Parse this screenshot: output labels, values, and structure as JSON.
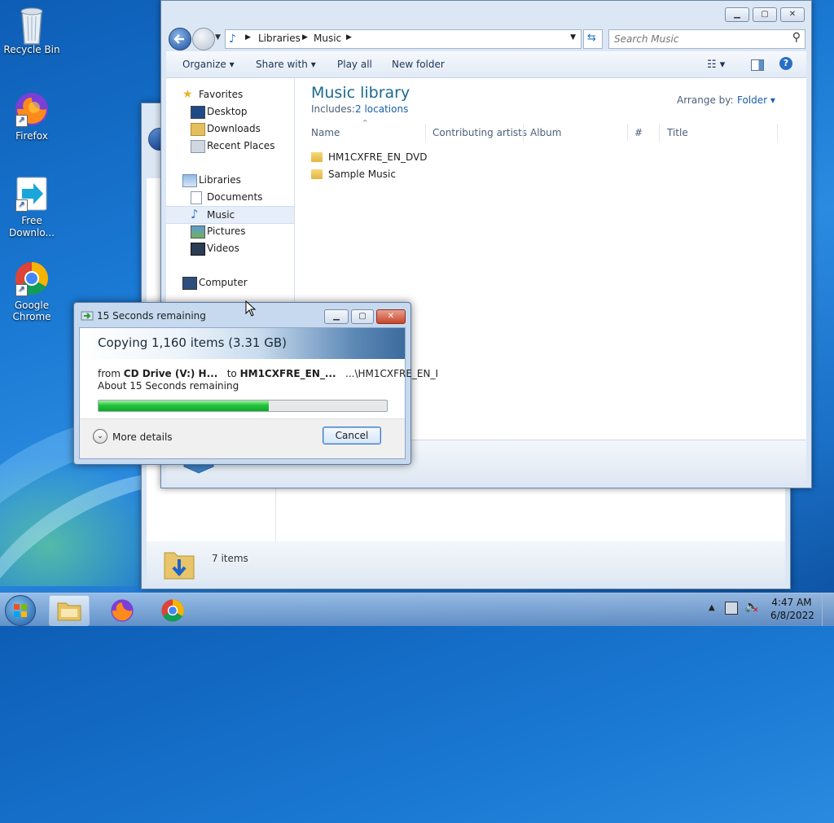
{
  "desktop": {
    "icons": [
      {
        "label": "Recycle Bin"
      },
      {
        "label": "Firefox"
      },
      {
        "label": "Free Downlo..."
      },
      {
        "label": "Google Chrome"
      }
    ]
  },
  "explorer": {
    "breadcrumb": [
      "Libraries",
      "Music"
    ],
    "search_placeholder": "Search Music",
    "commands": [
      "Organize",
      "Share with",
      "Play all",
      "New folder"
    ],
    "nav": {
      "favorites": "Favorites",
      "desktop": "Desktop",
      "downloads": "Downloads",
      "recent": "Recent Places",
      "libraries": "Libraries",
      "documents": "Documents",
      "music": "Music",
      "pictures": "Pictures",
      "videos": "Videos",
      "computer": "Computer"
    },
    "library_title": "Music library",
    "includes_label": "Includes:",
    "includes_link": "2 locations",
    "arrange_label": "Arrange by:",
    "arrange_value": "Folder",
    "columns": [
      "Name",
      "Contributing artists",
      "Album",
      "#",
      "Title"
    ],
    "items": [
      "HM1CXFRE_EN_DVD",
      "Sample Music"
    ]
  },
  "back_window": {
    "status": "7 items"
  },
  "copy_dialog": {
    "title": "15 Seconds remaining",
    "heading": "Copying 1,160 items (3.31 GB)",
    "from_label": "from",
    "from_value": "CD Drive (V:) H...",
    "to_label": "to",
    "to_value": "HM1CXFRE_EN_...",
    "dest_path": "...\\HM1CXFRE_EN_I",
    "remaining": "About 15 Seconds remaining",
    "progress_fraction": 0.59,
    "more_details": "More details",
    "cancel": "Cancel"
  },
  "taskbar": {
    "time": "4:47 AM",
    "date": "6/8/2022"
  },
  "colors": {
    "accent_title": "#1b6a8f",
    "link": "#1a5fb0",
    "progress": "#22c33a"
  }
}
